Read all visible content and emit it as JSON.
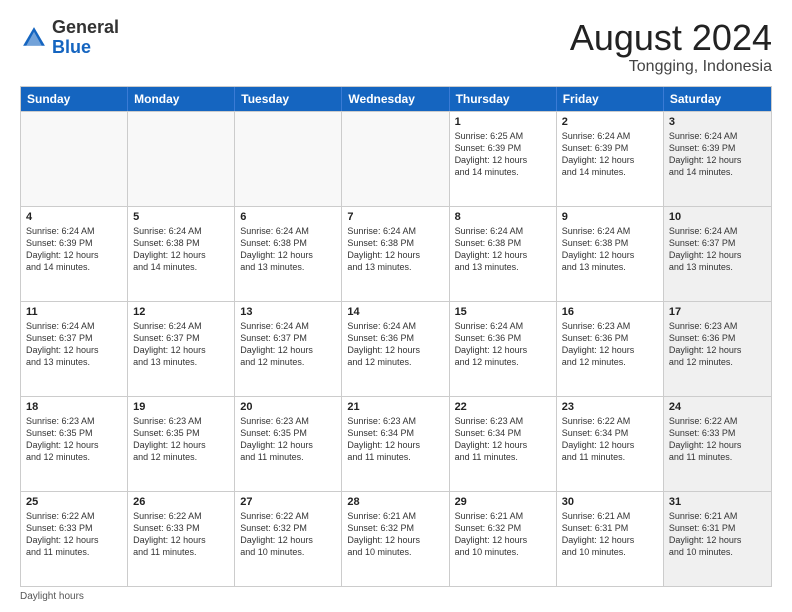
{
  "header": {
    "logo_general": "General",
    "logo_blue": "Blue",
    "month_year": "August 2024",
    "location": "Tongging, Indonesia"
  },
  "days_of_week": [
    "Sunday",
    "Monday",
    "Tuesday",
    "Wednesday",
    "Thursday",
    "Friday",
    "Saturday"
  ],
  "footer": {
    "daylight_label": "Daylight hours"
  },
  "rows": [
    {
      "cells": [
        {
          "day": "",
          "empty": true
        },
        {
          "day": "",
          "empty": true
        },
        {
          "day": "",
          "empty": true
        },
        {
          "day": "",
          "empty": true
        },
        {
          "day": "1",
          "lines": [
            "Sunrise: 6:25 AM",
            "Sunset: 6:39 PM",
            "Daylight: 12 hours",
            "and 14 minutes."
          ]
        },
        {
          "day": "2",
          "lines": [
            "Sunrise: 6:24 AM",
            "Sunset: 6:39 PM",
            "Daylight: 12 hours",
            "and 14 minutes."
          ]
        },
        {
          "day": "3",
          "shaded": true,
          "lines": [
            "Sunrise: 6:24 AM",
            "Sunset: 6:39 PM",
            "Daylight: 12 hours",
            "and 14 minutes."
          ]
        }
      ]
    },
    {
      "cells": [
        {
          "day": "4",
          "lines": [
            "Sunrise: 6:24 AM",
            "Sunset: 6:39 PM",
            "Daylight: 12 hours",
            "and 14 minutes."
          ]
        },
        {
          "day": "5",
          "lines": [
            "Sunrise: 6:24 AM",
            "Sunset: 6:38 PM",
            "Daylight: 12 hours",
            "and 14 minutes."
          ]
        },
        {
          "day": "6",
          "lines": [
            "Sunrise: 6:24 AM",
            "Sunset: 6:38 PM",
            "Daylight: 12 hours",
            "and 13 minutes."
          ]
        },
        {
          "day": "7",
          "lines": [
            "Sunrise: 6:24 AM",
            "Sunset: 6:38 PM",
            "Daylight: 12 hours",
            "and 13 minutes."
          ]
        },
        {
          "day": "8",
          "lines": [
            "Sunrise: 6:24 AM",
            "Sunset: 6:38 PM",
            "Daylight: 12 hours",
            "and 13 minutes."
          ]
        },
        {
          "day": "9",
          "lines": [
            "Sunrise: 6:24 AM",
            "Sunset: 6:38 PM",
            "Daylight: 12 hours",
            "and 13 minutes."
          ]
        },
        {
          "day": "10",
          "shaded": true,
          "lines": [
            "Sunrise: 6:24 AM",
            "Sunset: 6:37 PM",
            "Daylight: 12 hours",
            "and 13 minutes."
          ]
        }
      ]
    },
    {
      "cells": [
        {
          "day": "11",
          "lines": [
            "Sunrise: 6:24 AM",
            "Sunset: 6:37 PM",
            "Daylight: 12 hours",
            "and 13 minutes."
          ]
        },
        {
          "day": "12",
          "lines": [
            "Sunrise: 6:24 AM",
            "Sunset: 6:37 PM",
            "Daylight: 12 hours",
            "and 13 minutes."
          ]
        },
        {
          "day": "13",
          "lines": [
            "Sunrise: 6:24 AM",
            "Sunset: 6:37 PM",
            "Daylight: 12 hours",
            "and 12 minutes."
          ]
        },
        {
          "day": "14",
          "lines": [
            "Sunrise: 6:24 AM",
            "Sunset: 6:36 PM",
            "Daylight: 12 hours",
            "and 12 minutes."
          ]
        },
        {
          "day": "15",
          "lines": [
            "Sunrise: 6:24 AM",
            "Sunset: 6:36 PM",
            "Daylight: 12 hours",
            "and 12 minutes."
          ]
        },
        {
          "day": "16",
          "lines": [
            "Sunrise: 6:23 AM",
            "Sunset: 6:36 PM",
            "Daylight: 12 hours",
            "and 12 minutes."
          ]
        },
        {
          "day": "17",
          "shaded": true,
          "lines": [
            "Sunrise: 6:23 AM",
            "Sunset: 6:36 PM",
            "Daylight: 12 hours",
            "and 12 minutes."
          ]
        }
      ]
    },
    {
      "cells": [
        {
          "day": "18",
          "lines": [
            "Sunrise: 6:23 AM",
            "Sunset: 6:35 PM",
            "Daylight: 12 hours",
            "and 12 minutes."
          ]
        },
        {
          "day": "19",
          "lines": [
            "Sunrise: 6:23 AM",
            "Sunset: 6:35 PM",
            "Daylight: 12 hours",
            "and 12 minutes."
          ]
        },
        {
          "day": "20",
          "lines": [
            "Sunrise: 6:23 AM",
            "Sunset: 6:35 PM",
            "Daylight: 12 hours",
            "and 11 minutes."
          ]
        },
        {
          "day": "21",
          "lines": [
            "Sunrise: 6:23 AM",
            "Sunset: 6:34 PM",
            "Daylight: 12 hours",
            "and 11 minutes."
          ]
        },
        {
          "day": "22",
          "lines": [
            "Sunrise: 6:23 AM",
            "Sunset: 6:34 PM",
            "Daylight: 12 hours",
            "and 11 minutes."
          ]
        },
        {
          "day": "23",
          "lines": [
            "Sunrise: 6:22 AM",
            "Sunset: 6:34 PM",
            "Daylight: 12 hours",
            "and 11 minutes."
          ]
        },
        {
          "day": "24",
          "shaded": true,
          "lines": [
            "Sunrise: 6:22 AM",
            "Sunset: 6:33 PM",
            "Daylight: 12 hours",
            "and 11 minutes."
          ]
        }
      ]
    },
    {
      "cells": [
        {
          "day": "25",
          "lines": [
            "Sunrise: 6:22 AM",
            "Sunset: 6:33 PM",
            "Daylight: 12 hours",
            "and 11 minutes."
          ]
        },
        {
          "day": "26",
          "lines": [
            "Sunrise: 6:22 AM",
            "Sunset: 6:33 PM",
            "Daylight: 12 hours",
            "and 11 minutes."
          ]
        },
        {
          "day": "27",
          "lines": [
            "Sunrise: 6:22 AM",
            "Sunset: 6:32 PM",
            "Daylight: 12 hours",
            "and 10 minutes."
          ]
        },
        {
          "day": "28",
          "lines": [
            "Sunrise: 6:21 AM",
            "Sunset: 6:32 PM",
            "Daylight: 12 hours",
            "and 10 minutes."
          ]
        },
        {
          "day": "29",
          "lines": [
            "Sunrise: 6:21 AM",
            "Sunset: 6:32 PM",
            "Daylight: 12 hours",
            "and 10 minutes."
          ]
        },
        {
          "day": "30",
          "lines": [
            "Sunrise: 6:21 AM",
            "Sunset: 6:31 PM",
            "Daylight: 12 hours",
            "and 10 minutes."
          ]
        },
        {
          "day": "31",
          "shaded": true,
          "lines": [
            "Sunrise: 6:21 AM",
            "Sunset: 6:31 PM",
            "Daylight: 12 hours",
            "and 10 minutes."
          ]
        }
      ]
    }
  ]
}
